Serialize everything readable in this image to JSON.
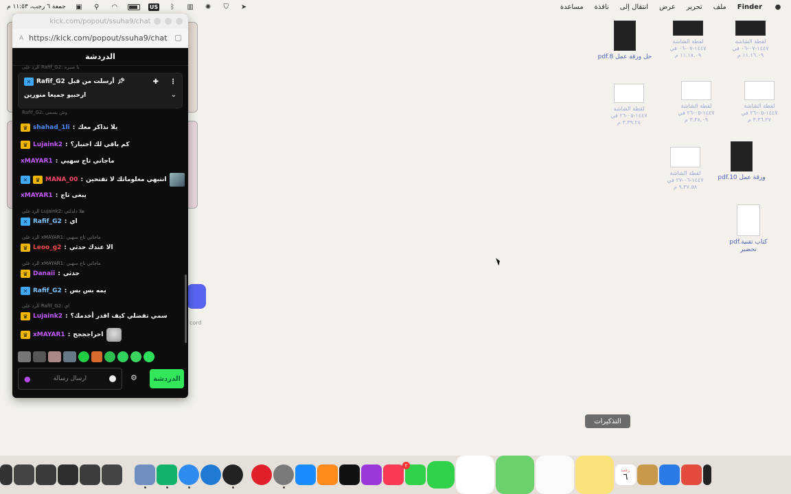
{
  "menubar": {
    "app": "Finder",
    "items": [
      "ملف",
      "تحرير",
      "عرض",
      "انتقال إلى",
      "نافذة",
      "مساعدة"
    ],
    "clock": "جمعة ٦ رجب، ١١:٥٣ م",
    "keyboard": "US"
  },
  "popout": {
    "window_title": "kick.com/popout/ssuha9/chat",
    "url": "https://kick.com/popout/ssuha9/chat",
    "header": "الدردشة",
    "pinned": {
      "by_label": "أرسلت من قبل",
      "user": "Rafif_G2",
      "message": "ارحبيو جميعا منورين"
    },
    "faded_top": "الرد على Rafif_G2: يا صبره",
    "faded_mid": "Rafif_G2: وش يسمى",
    "messages": [
      {
        "user": "shahad_1li",
        "text": "يلا نذاكر معك",
        "user_color": "#4c8dff"
      },
      {
        "user": "Lujaink2",
        "text": "كم باقي لك اختبار؟",
        "user_color": "#c35bff"
      },
      {
        "user": "xMAYAR1",
        "text": "ماجاني تاج سهيي",
        "user_color": "#c35bff"
      },
      {
        "user": "MANA_00",
        "text": "انتبهي معلوماتك لا تفتحين",
        "user_color": "#ff4a6a"
      },
      {
        "user": "xMAYAR1",
        "text": "يبغى تاج",
        "user_color": "#c35bff"
      },
      {
        "reply": "الرد على Lujaink2: هلا دلدلتي",
        "user": "Rafif_G2",
        "text": "اي",
        "user_color": "#7fc4ff"
      },
      {
        "reply": "الرد على xMAYAR1: ماجاني تاج سهيي",
        "user": "Leoo_g2",
        "text": "الا عندك حدثي",
        "user_color": "#ff4a4a"
      },
      {
        "reply": "الرد على xMAYAR1: ماجاني تاج سهيي",
        "user": "Danaii",
        "text": "حدثي",
        "user_color": "#c35bff"
      },
      {
        "user": "Rafif_G2",
        "text": "يمه بس بس",
        "user_color": "#7fc4ff"
      },
      {
        "reply": "الرد على Rafif_G2: اي",
        "user": "Lujaink2",
        "text": "سمي تفضلي كيف اقدر أخدمك؟",
        "user_color": "#c35bff"
      },
      {
        "user": "xMAYAR1",
        "text": "احراجججج",
        "user_color": "#c35bff"
      }
    ],
    "input_placeholder": "ارسال رسالة",
    "chat_button": "الدردشة"
  },
  "discord_label": "cord",
  "desktop_icons": [
    {
      "label": "لقطة الشاشة ١٤٤٧-٠٧-٠٦ في ١١.١٦.٠٩ م",
      "style": "dark"
    },
    {
      "label": "لقطة الشاشة ١٤٤٧-٠٧-٠٦ في ١١.١٨.٠٩ م",
      "style": "dark"
    },
    {
      "label": "pdf.حل ورقة عمل 8",
      "style": "dark"
    },
    {
      "label": "لقطة الشاشة ١٤٤٧-٠٥-٢٦ في ٣.٣٦.٢٧ م",
      "style": "light"
    },
    {
      "label": "لقطة الشاشة ١٤٤٧-٠٥-٢٦ في ٣.٣٨.٠٩ م",
      "style": "light"
    },
    {
      "label": "لقطة الشاشة ١٤٤٧-٠٥-٢٦ في ٣.٣٩.٢٤ م",
      "style": "light"
    },
    {
      "label": "pdf.ورقة عمل 10",
      "style": "dark"
    },
    {
      "label": "لقطة الشاشة ١٤٤٧-٠٦-٢٧ في ٩.٣٧.٥٨ م",
      "style": "light"
    },
    {
      "label": "pdf.كتاب تقنية تحضير",
      "style": "doc"
    }
  ],
  "dock_tooltip": "التذكيرات",
  "calendar": {
    "month": "رجب",
    "day": "٦"
  },
  "facetime_badge": "٢"
}
